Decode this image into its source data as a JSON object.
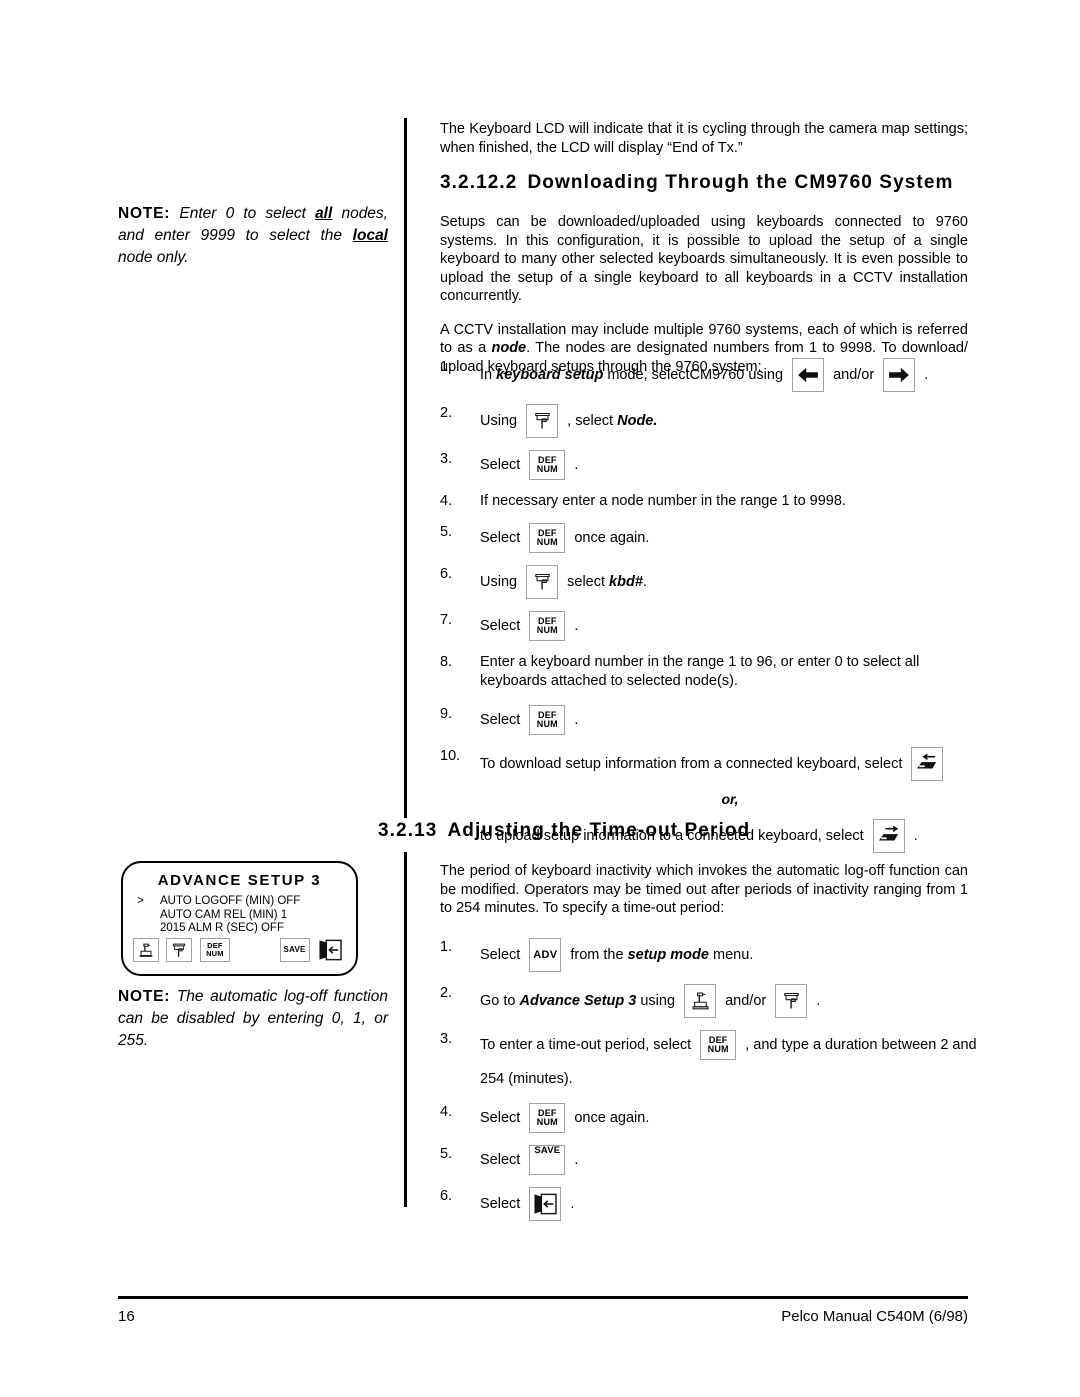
{
  "page": {
    "number": "16",
    "footer_right": "Pelco Manual C540M (6/98)"
  },
  "margin_notes": [
    {
      "label": "NOTE:",
      "text_parts": [
        "Enter 0 to select ",
        "all",
        " nodes, and enter 9999 to select the ",
        "local",
        " node only."
      ]
    },
    {
      "label": "NOTE:",
      "text": "The automatic log-off function can be disabled by entering 0, 1, or 255."
    }
  ],
  "advance_setup_box": {
    "title": "ADVANCE SETUP 3",
    "caret": ">",
    "lines": [
      "AUTO LOGOFF (MIN) OFF",
      "AUTO CAM REL (MIN) 1",
      "2015 ALM R (SEC) OFF"
    ],
    "icons_left": [
      "joystick-up-icon",
      "joystick-down-icon",
      "def-num-key-icon"
    ],
    "icons_right": [
      "save-key-icon",
      "exit-door-key-icon"
    ],
    "def_num_label_top": "DEF",
    "def_num_label_bottom": "NUM",
    "save_label": "SAVE"
  },
  "intro_paragraph": "The Keyboard LCD will indicate that it is cycling through the camera map settings; when finished, the LCD will display “End of Tx.”",
  "section_1": {
    "number": "3.2.12.2",
    "title": "Downloading Through the CM9760 System",
    "paragraphs": [
      "Setups can be downloaded/uploaded using keyboards connected to 9760 systems. In this configuration, it is possible to upload the setup of a single keyboard to many other selected keyboards simultaneously. It is even possible to upload the setup of a single keyboard to all keyboards in a CCTV installation concurrently.",
      "A CCTV installation may include multiple 9760 systems, each of which is referred to as a node. The nodes are designated numbers from 1 to 9998. To download/ upload keyboard setups through the 9760 system:"
    ],
    "paragraph2_bold_word": "node",
    "steps": [
      {
        "n": "1.",
        "segments": [
          {
            "t": "text",
            "v": "In "
          },
          {
            "t": "bolditalic",
            "v": "keyboard setup"
          },
          {
            "t": "text",
            "v": " mode, selectCM9760 using "
          },
          {
            "t": "icon",
            "v": "arrow-left-key-icon"
          },
          {
            "t": "text",
            "v": " and/or "
          },
          {
            "t": "icon",
            "v": "arrow-right-key-icon"
          },
          {
            "t": "text",
            "v": " ."
          }
        ]
      },
      {
        "n": "2.",
        "segments": [
          {
            "t": "text",
            "v": "Using "
          },
          {
            "t": "icon",
            "v": "joystick-down-key-icon"
          },
          {
            "t": "text",
            "v": " , select "
          },
          {
            "t": "bolditalic",
            "v": "Node."
          }
        ]
      },
      {
        "n": "3.",
        "segments": [
          {
            "t": "text",
            "v": "Select "
          },
          {
            "t": "icon",
            "v": "def-num-key-icon"
          },
          {
            "t": "text",
            "v": " ."
          }
        ]
      },
      {
        "n": "4.",
        "segments": [
          {
            "t": "text",
            "v": "If necessary enter a node number in the range 1 to 9998."
          }
        ]
      },
      {
        "n": "5.",
        "segments": [
          {
            "t": "text",
            "v": "Select "
          },
          {
            "t": "icon",
            "v": "def-num-key-icon"
          },
          {
            "t": "text",
            "v": " once again."
          }
        ]
      },
      {
        "n": "6.",
        "segments": [
          {
            "t": "text",
            "v": "Using "
          },
          {
            "t": "icon",
            "v": "joystick-down-key-icon"
          },
          {
            "t": "text",
            "v": " select "
          },
          {
            "t": "bolditalic",
            "v": "kbd#"
          },
          {
            "t": "text",
            "v": "."
          }
        ]
      },
      {
        "n": "7.",
        "segments": [
          {
            "t": "text",
            "v": "Select "
          },
          {
            "t": "icon",
            "v": "def-num-key-icon"
          },
          {
            "t": "text",
            "v": " ."
          }
        ]
      },
      {
        "n": "8.",
        "segments": [
          {
            "t": "text",
            "v": "Enter a keyboard number in the range 1 to 96, or enter 0 to select all keyboards attached to selected node(s)."
          }
        ]
      },
      {
        "n": "9.",
        "segments": [
          {
            "t": "text",
            "v": "Select "
          },
          {
            "t": "icon",
            "v": "def-num-key-icon"
          },
          {
            "t": "text",
            "v": " ."
          }
        ]
      },
      {
        "n": "10.",
        "segments": [
          {
            "t": "text",
            "v": "To download setup information from a connected keyboard, select "
          },
          {
            "t": "icon",
            "v": "download-keyboard-key-icon"
          }
        ]
      }
    ],
    "or_label": "or,",
    "upload_line": {
      "text": "to upload setup information to a connected keyboard, select ",
      "icon": "upload-keyboard-key-icon",
      "trailing": " ."
    }
  },
  "section_2": {
    "number": "3.2.13",
    "title": "Adjusting the Time-out Period",
    "paragraph": "The period of keyboard inactivity which invokes the automatic log-off function can be modified. Operators may be timed out after periods of inactivity ranging from 1 to 254 minutes. To specify a time-out period:",
    "steps": [
      {
        "n": "1.",
        "segments": [
          {
            "t": "text",
            "v": "Select "
          },
          {
            "t": "icon",
            "v": "adv-key-icon"
          },
          {
            "t": "text",
            "v": " from the "
          },
          {
            "t": "bolditalic",
            "v": "setup mode"
          },
          {
            "t": "text",
            "v": " menu."
          }
        ]
      },
      {
        "n": "2.",
        "segments": [
          {
            "t": "text",
            "v": "Go to "
          },
          {
            "t": "bolditalic",
            "v": "Advance Setup 3"
          },
          {
            "t": "text",
            "v": " using "
          },
          {
            "t": "icon",
            "v": "joystick-up-key-icon"
          },
          {
            "t": "text",
            "v": " and/or "
          },
          {
            "t": "icon",
            "v": "joystick-down-key-icon"
          },
          {
            "t": "text",
            "v": " ."
          }
        ]
      },
      {
        "n": "3.",
        "segments": [
          {
            "t": "text",
            "v": "To enter a time-out period, select "
          },
          {
            "t": "icon",
            "v": "def-num-key-icon"
          },
          {
            "t": "text",
            "v": " , and type a duration between 2 and"
          }
        ],
        "second_line": "254 (minutes)."
      },
      {
        "n": "4.",
        "segments": [
          {
            "t": "text",
            "v": "Select "
          },
          {
            "t": "icon",
            "v": "def-num-key-icon"
          },
          {
            "t": "text",
            "v": " once again."
          }
        ]
      },
      {
        "n": "5.",
        "segments": [
          {
            "t": "text",
            "v": "Select "
          },
          {
            "t": "icon",
            "v": "save-key-icon"
          },
          {
            "t": "text",
            "v": " ."
          }
        ]
      },
      {
        "n": "6.",
        "segments": [
          {
            "t": "text",
            "v": "Select "
          },
          {
            "t": "icon",
            "v": "exit-door-key-icon"
          },
          {
            "t": "text",
            "v": " ."
          }
        ]
      }
    ]
  },
  "key_labels": {
    "def": "DEF",
    "num": "NUM",
    "adv": "ADV",
    "save": "SAVE"
  }
}
